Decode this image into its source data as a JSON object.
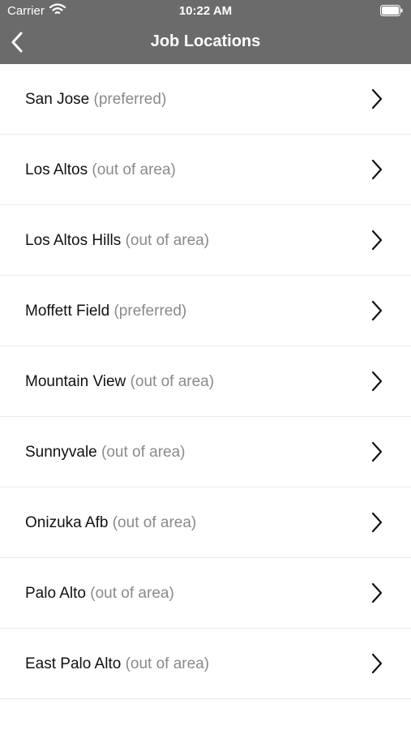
{
  "status_bar": {
    "carrier": "Carrier",
    "time": "10:22 AM",
    "wifi_icon": "wifi-icon",
    "battery_icon": "battery-icon"
  },
  "nav": {
    "title": "Job Locations",
    "back_icon": "chevron-left-icon",
    "bar_color": "#6b6b6b"
  },
  "locations": [
    {
      "city": "San Jose",
      "status": "(preferred)"
    },
    {
      "city": "Los Altos",
      "status": "(out of area)"
    },
    {
      "city": "Los Altos Hills",
      "status": "(out of area)"
    },
    {
      "city": "Moffett Field",
      "status": "(preferred)"
    },
    {
      "city": "Mountain View",
      "status": "(out of area)"
    },
    {
      "city": "Sunnyvale",
      "status": "(out of area)"
    },
    {
      "city": "Onizuka Afb",
      "status": "(out of area)"
    },
    {
      "city": "Palo Alto",
      "status": "(out of area)"
    },
    {
      "city": "East Palo Alto",
      "status": "(out of area)"
    }
  ],
  "row_icon": "chevron-right-icon"
}
